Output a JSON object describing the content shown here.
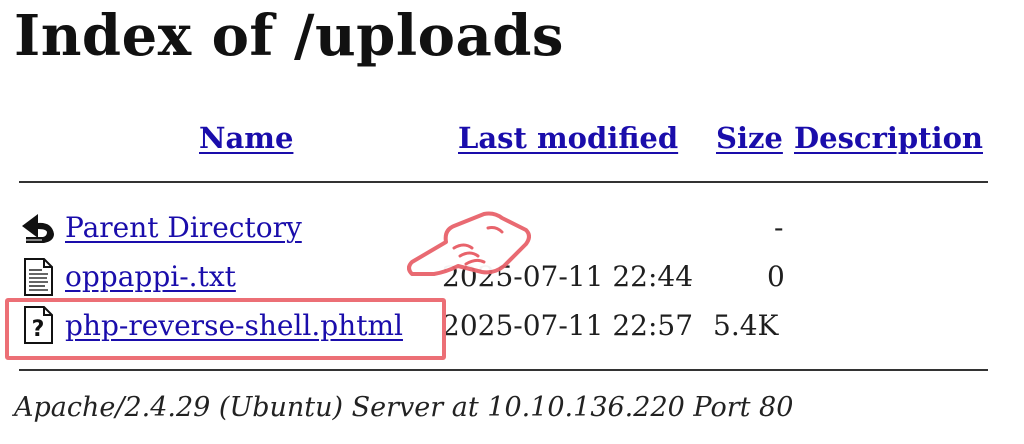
{
  "title": "Index of /uploads",
  "columns": {
    "name": "Name",
    "last_modified": "Last modified",
    "size": "Size",
    "description": "Description"
  },
  "rows": [
    {
      "icon": "parent-directory-icon",
      "name": "Parent Directory",
      "modified": "",
      "size": "-"
    },
    {
      "icon": "text-file-icon",
      "name": "oppappi-.txt",
      "modified": "2025-07-11 22:44",
      "size": "0"
    },
    {
      "icon": "unknown-file-icon",
      "name": "php-reverse-shell.phtml",
      "modified": "2025-07-11 22:57",
      "size": "5.4K"
    }
  ],
  "footer": "Apache/2.4.29 (Ubuntu) Server at 10.10.136.220 Port 80",
  "colors": {
    "link": "#1a0dab",
    "highlight": "#ec6f76"
  }
}
